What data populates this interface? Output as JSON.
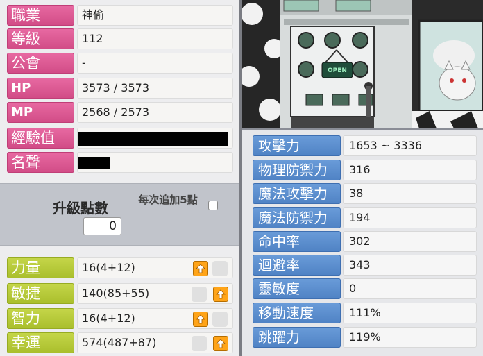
{
  "profile": {
    "rows": [
      {
        "label": "職業",
        "value": "神偷"
      },
      {
        "label": "等級",
        "value": "112"
      },
      {
        "label": "公會",
        "value": "-"
      },
      {
        "label": "HP",
        "value": "3573 / 3573"
      },
      {
        "label": "MP",
        "value": "2568 / 2573"
      },
      {
        "label": "經驗值",
        "value": ""
      },
      {
        "label": "名聲",
        "value": ""
      }
    ]
  },
  "level_up": {
    "ap_label": "升級點數",
    "ap_value": "0",
    "auto_label": "每次追加5點"
  },
  "base_stats": [
    {
      "label": "力量",
      "value": "16(4+12)"
    },
    {
      "label": "敏捷",
      "value": "140(85+55)"
    },
    {
      "label": "智力",
      "value": "16(4+12)"
    },
    {
      "label": "幸運",
      "value": "574(487+87)"
    }
  ],
  "scene": {
    "sign": "OPEN"
  },
  "combat_stats": [
    {
      "label": "攻擊力",
      "value": "1653 ~ 3336"
    },
    {
      "label": "物理防禦力",
      "value": "316"
    },
    {
      "label": "魔法攻擊力",
      "value": "38"
    },
    {
      "label": "魔法防禦力",
      "value": "194"
    },
    {
      "label": "命中率",
      "value": "302"
    },
    {
      "label": "迴避率",
      "value": "343"
    },
    {
      "label": "靈敏度",
      "value": "0"
    },
    {
      "label": "移動速度",
      "value": "111%"
    },
    {
      "label": "跳躍力",
      "value": "119%"
    }
  ],
  "colors": {
    "profile_label": "#d14b86",
    "stat_label": "#a9be2c",
    "combat_label": "#4f82c4",
    "plus_button": "#ffa418"
  }
}
